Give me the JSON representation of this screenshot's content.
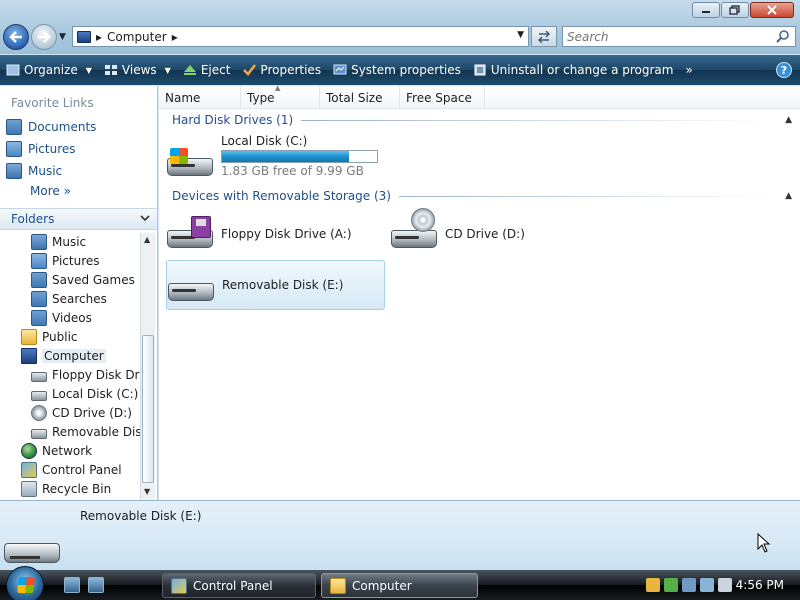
{
  "address": {
    "location": "Computer",
    "search_placeholder": "Search"
  },
  "toolbar": {
    "organize": "Organize",
    "views": "Views",
    "eject": "Eject",
    "properties": "Properties",
    "system_properties": "System properties",
    "uninstall": "Uninstall or change a program",
    "more": "»"
  },
  "favorites": {
    "title": "Favorite Links",
    "items": [
      "Documents",
      "Pictures",
      "Music"
    ],
    "more": "More"
  },
  "folders": {
    "title": "Folders",
    "tree": [
      {
        "label": "Music",
        "icon": "music-icon"
      },
      {
        "label": "Pictures",
        "icon": "pictures-icon"
      },
      {
        "label": "Saved Games",
        "icon": "saved-games-icon"
      },
      {
        "label": "Searches",
        "icon": "searches-icon"
      },
      {
        "label": "Videos",
        "icon": "videos-icon"
      },
      {
        "label": "Public",
        "icon": "folder-icon"
      },
      {
        "label": "Computer",
        "icon": "computer-icon"
      },
      {
        "label": "Floppy Disk Drive",
        "icon": "floppy-drive-icon"
      },
      {
        "label": "Local Disk (C:)",
        "icon": "hard-disk-icon"
      },
      {
        "label": "CD Drive (D:)",
        "icon": "cd-drive-icon"
      },
      {
        "label": "Removable Disk",
        "icon": "removable-disk-icon"
      },
      {
        "label": "Network",
        "icon": "network-icon"
      },
      {
        "label": "Control Panel",
        "icon": "control-panel-icon"
      },
      {
        "label": "Recycle Bin",
        "icon": "recycle-bin-icon"
      }
    ]
  },
  "columns": [
    "Name",
    "Type",
    "Total Size",
    "Free Space"
  ],
  "groups": {
    "hdd": {
      "title": "Hard Disk Drives (1)",
      "items": [
        {
          "name": "Local Disk (C:)",
          "free_text": "1.83 GB free of 9.99 GB",
          "used_fraction": 0.817
        }
      ]
    },
    "removable": {
      "title": "Devices with Removable Storage (3)",
      "items": [
        {
          "name": "Floppy Disk Drive (A:)"
        },
        {
          "name": "CD Drive (D:)"
        },
        {
          "name": "Removable Disk (E:)"
        }
      ]
    }
  },
  "details": {
    "title": "Removable Disk (E:)"
  },
  "taskbar": {
    "tasks": [
      "Control Panel",
      "Computer"
    ],
    "clock": "4:56 PM"
  },
  "colors": {
    "toolbar": "#1d4666",
    "link": "#1f4f8a",
    "selection": "#d5e9f7",
    "capacity_fill": "#1e8fcb"
  }
}
